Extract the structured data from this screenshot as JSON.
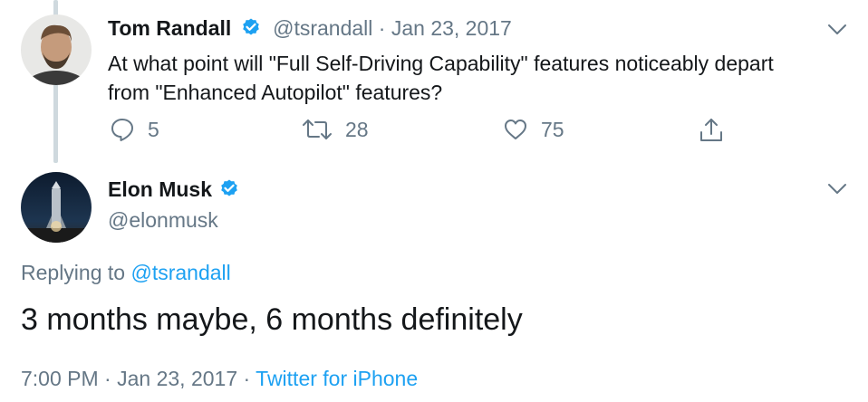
{
  "reply_to_tweet": {
    "author_name": "Tom Randall",
    "handle": "@tsrandall",
    "separator": "·",
    "date": "Jan 23, 2017",
    "text_line1": "At what point will \"Full Self-Driving Capability\" features noticeably depart",
    "text_line2": "from \"Enhanced Autopilot\" features?",
    "actions": {
      "reply_count": "5",
      "retweet_count": "28",
      "like_count": "75"
    },
    "icons": [
      "verified-badge-icon",
      "chevron-down-icon",
      "reply-icon",
      "retweet-icon",
      "heart-icon",
      "share-icon"
    ]
  },
  "main_tweet": {
    "author_name": "Elon Musk",
    "handle": "@elonmusk",
    "replying_prefix": "Replying to",
    "replying_handle": "@tsrandall",
    "text": "3 months maybe, 6 months definitely",
    "time": "7:00 PM",
    "separator": "·",
    "date": "Jan 23, 2017",
    "source": "Twitter for iPhone"
  },
  "colors": {
    "accent": "#1da1f2",
    "text": "#14171a",
    "muted": "#657786",
    "thread_line": "#cfd9de"
  }
}
